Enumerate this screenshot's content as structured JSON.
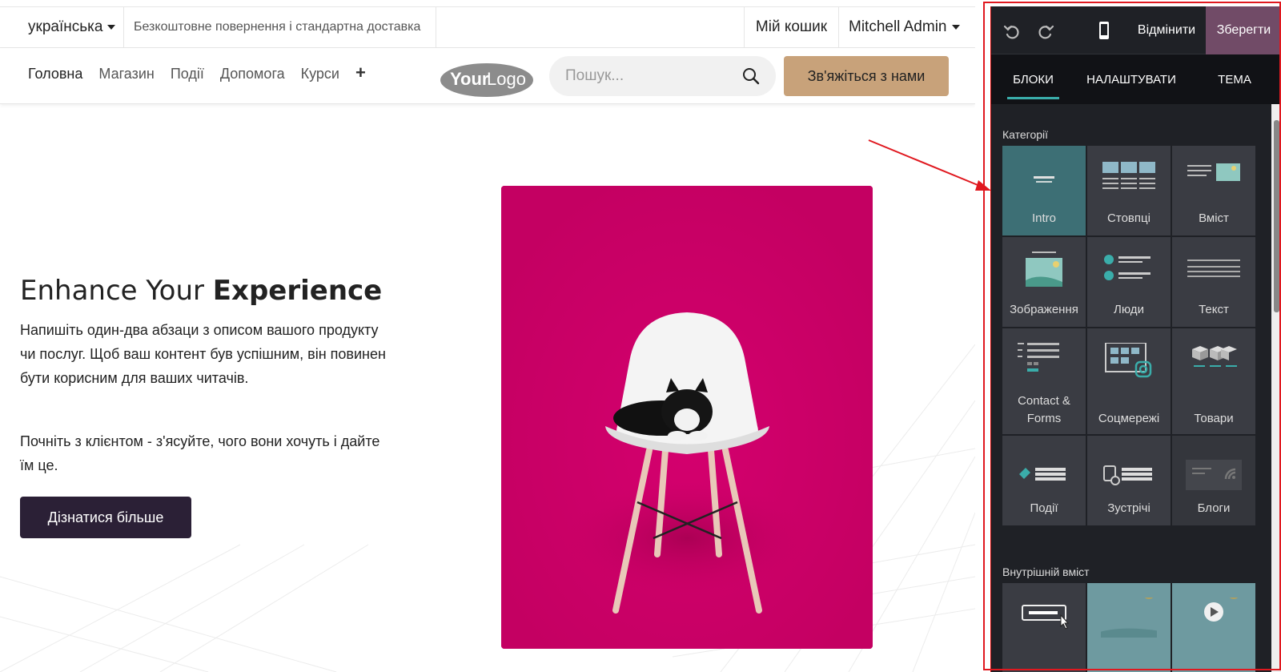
{
  "topbar": {
    "language": "українська",
    "promo": "Безкоштовне повернення і стандартна доставка",
    "cart": "Мій кошик",
    "user": "Mitchell Admin"
  },
  "navbar": {
    "links": [
      "Головна",
      "Магазин",
      "Події",
      "Допомога",
      "Курси"
    ],
    "logo_text_1": "Your",
    "logo_text_2": "Logo",
    "search_placeholder": "Пошук...",
    "contact_label": "Зв'яжіться з нами"
  },
  "hero": {
    "title_plain": "Enhance Your ",
    "title_bold": "Experience",
    "paragraph_1": "Напишіть один-два абзаци з описом вашого продукту чи послуг. Щоб ваш контент був успішним, він повинен бути корисним для ваших читачів.",
    "paragraph_2": "Почніть з клієнтом - з'ясуйте, чого вони хочуть і дайте їм це.",
    "button_label": "Дізнатися більше"
  },
  "editor": {
    "discard_label": "Відмінити",
    "save_label": "Зберегти",
    "tabs": [
      "БЛОКИ",
      "НАЛАШТУВАТИ",
      "ТЕМА"
    ],
    "categories_title": "Категорії",
    "categories": [
      "Intro",
      "Стовпці",
      "Вміст",
      "Зображення",
      "Люди",
      "Текст",
      "Contact & Forms",
      "Соцмережі",
      "Товари",
      "Події",
      "Зустрічі",
      "Блоги"
    ],
    "inner_title": "Внутрішній вміст",
    "colors": {
      "accent": "#3aadaa",
      "save": "#714b67",
      "panel": "#1f2126",
      "tile": "#3a3c43",
      "frame": "#e0181f"
    }
  }
}
